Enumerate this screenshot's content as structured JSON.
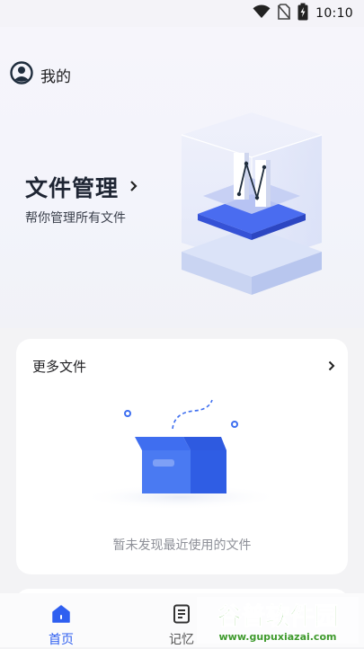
{
  "status_bar": {
    "time": "10:10",
    "icons": [
      "wifi-icon",
      "no-sim-icon",
      "battery-charging-icon"
    ]
  },
  "header": {
    "profile_label": "我的",
    "profile_icon": "user-circle-icon"
  },
  "hero": {
    "title": "文件管理",
    "subtitle": "帮你管理所有文件",
    "chevron_icon": "chevron-right-icon"
  },
  "recent_card": {
    "title": "更多文件",
    "empty_text": "暂未发现最近使用的文件",
    "chevron_icon": "chevron-right-icon",
    "illustration": "empty-box"
  },
  "bottom_nav": {
    "items": [
      {
        "label": "首页",
        "icon": "home-icon",
        "active": true
      },
      {
        "label": "记忆",
        "icon": "notes-icon",
        "active": false
      }
    ]
  },
  "watermark": {
    "brand": "谷普软件园",
    "url": "www.gupuxiazai.com"
  },
  "colors": {
    "accent": "#2f5ff0",
    "box_blue": "#3d6ef0",
    "background": "#f3f3f5"
  }
}
